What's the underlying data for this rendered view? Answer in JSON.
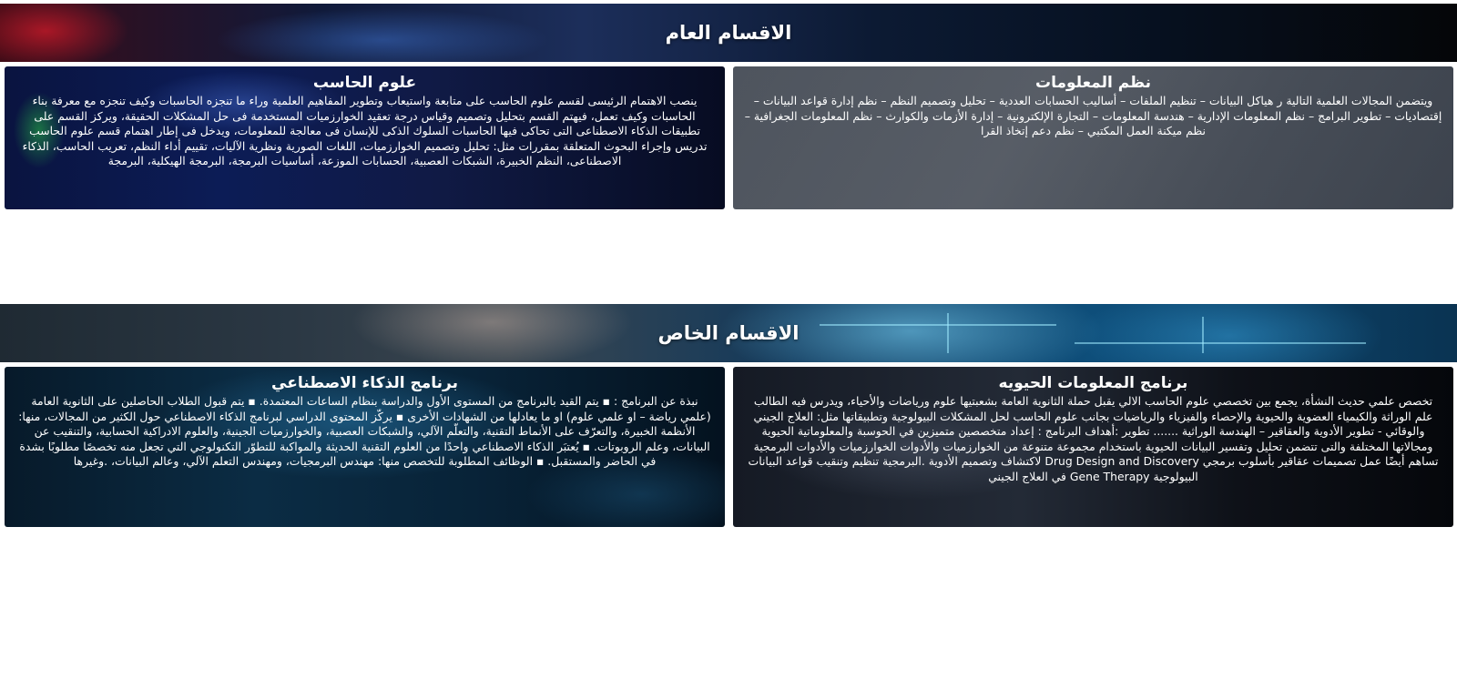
{
  "general_section": {
    "title": "الاقسام العام",
    "cards": [
      {
        "title": "نظم المعلومات",
        "body": "ويتضمن المجالات العلمية التالية ر هياكل البيانات – تنظيم الملفات – أساليب الحسابات العددية – تحليل وتصميم النظم – نظم إدارة قواعد البيانات – إقتصاديات – تطوير البرامج – نظم المعلومات الإدارية – هندسة المعلومات – التجارة الإلكترونية – إدارة الأزمات والكوارث – نظم المعلومات الجغرافية – نظم ميكنة العمل المكتبي – نظم دعم إتخاذ القرا"
      },
      {
        "title": "علوم الحاسب",
        "body": "ينصب الاهتمام الرئيسى لقسم علوم الحاسب على متابعة واستيعاب وتطوير المفاهيم العلمية وراء ما تنجزه الحاسبات وكيف تنجزه مع معرفة بناء الحاسبات وكيف تعمل، فيهتم القسم بتحليل وتصميم وقياس درجة تعقيد الخوارزميات المستخدمة فى حل المشكلات الحقيقة، ويركز القسم على تطبيقات الذكاء الاصطناعى التى تحاكى فيها الحاسبات السلوك الذكى للإنسان فى معالجة للمعلومات، ويدخل فى إطار اهتمام قسم علوم الحاسب تدريس وإجراء البحوث المتعلقة بمقررات مثل: تحليل وتصميم الخوارزميات، اللغات الصورية ونظرية الآليات، تقييم أداء النظم، تعريب الحاسب، الذكاء الاصطناعى، النظم الخبيرة، الشبكات العصبية، الحسابات الموزعة، أساسيات البرمجة، البرمجة الهيكلية، البرمجة"
      }
    ]
  },
  "special_section": {
    "title": "الاقسام الخاص",
    "cards": [
      {
        "title": "برنامج المعلومات الحيويه",
        "body": "تخصص علمي حديث النشأة، يجمع بين تخصصي علوم الحاسب الالي  يقبل حملة الثانوية العامة بشعبتيها علوم ورياضات  والأحياء، ويدرس فيه الطالب علم الوراثة والكيمياء العضوية والحيوية والإحصاء والفيزياء والرياضيات بجانب علوم الحاسب لحل المشكلات البيولوجية وتطبيقاتها مثل: العلاج الجيني والوقائي - تطوير الأدوية والعقاقير – الهندسة الوراثية ....... تطوير  :أهداف البرنامج : إعداد متخصصين متميزين في الحوسبة والمعلوماتية الحيوية ومجالاتها المختلفة والتى تتضمن تحليل وتفسير البيانات الحيوية باستخدام مجموعة متنوعة من الخوارزميات والأدوات  الخوارزميات والأدوات البرمجية تساهم أيضًا  عمل تصميمات عقاقير بأسلوب برمجي  Drug Design and Discovery لاكتشاف وتصميم الأدوية  .البرمجية تنظيم وتنقيب قواعد البيانات البيولوجية  Gene Therapy في العلاج الجيني"
      },
      {
        "title": "برنامج الذكاء الاصطناعي",
        "body": "نبذة عن البرنامج : ▪ يتم القيد بالبرنامج من المستوى الأول والدراسة بنظام الساعات المعتمدة. ▪ يتم قبول الطلاب الحاصلين على الثانوية العامة (علمي رياضة – او علمي علوم) او ما يعادلها من الشهادات الأخرى ▪ يركّز المحتوى الدراسي لبرنامج الذكاء الاصطناعي حول الكثير من المجالات، منها: الأنظمة الخبيرة، والتعرّف على الأنماط التقنية، والتعلّم الآلي، والشبكات العصبية، والخوارزميات الجينية، والعلوم الادراكية الحسابية، والتنقيب عن البيانات، وعلم الروبوتات. ▪ يُعتبَر الذكاء الاصطناعي واحدًا من العلوم التقنية الحديثة والمواكبة للتطوّر التكنولوجي التي تجعل منه تخصصًا مطلوبًا بشدة في الحاضر والمستقبل. ▪ الوظائف المطلوبة للتخصص منها: مهندس البرمجيات، ومهندس التعلم الآلي، وعالم البيانات، .وغيرها"
      }
    ]
  }
}
